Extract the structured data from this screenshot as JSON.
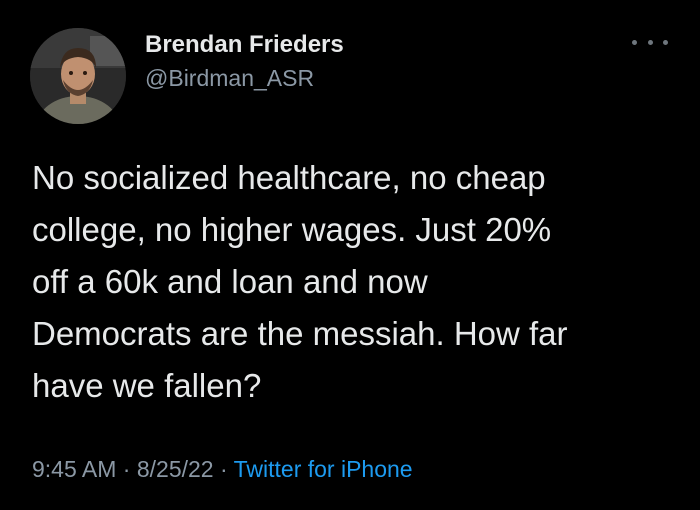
{
  "author": {
    "name": "Brendan Frieders",
    "handle": "@Birdman_ASR"
  },
  "menu": {
    "icon": "more-horizontal-icon"
  },
  "tweet": {
    "lines": [
      "No socialized healthcare, no cheap",
      "college, no higher wages. Just 20%",
      "off a 60k and loan and now",
      "Democrats are the messiah. How far",
      "have we fallen?"
    ]
  },
  "meta": {
    "time": "9:45 AM",
    "separator1": " · ",
    "date": "8/25/22",
    "separator2": " · ",
    "source": "Twitter for iPhone"
  },
  "colors": {
    "background": "#000000",
    "primary_text": "#e7e9ea",
    "secondary_text": "#8b98a5",
    "link": "#1d9bf0"
  }
}
